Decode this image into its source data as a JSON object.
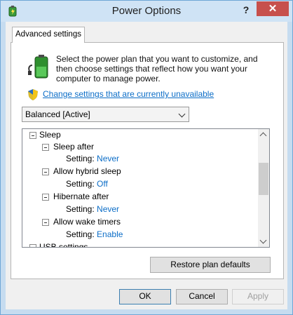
{
  "window": {
    "title": "Power Options",
    "help_label": "?",
    "close_label": "✕"
  },
  "tabs": [
    {
      "label": "Advanced settings"
    }
  ],
  "intro": {
    "description": "Select the power plan that you want to customize, and then choose settings that reflect how you want your computer to manage power."
  },
  "change_link": "Change settings that are currently unavailable",
  "plan_select": {
    "selected": "Balanced [Active]"
  },
  "tree": {
    "sleep": "Sleep",
    "sleep_after": {
      "label": "Sleep after",
      "setting_label": "Setting:",
      "value": "Never"
    },
    "hybrid_sleep": {
      "label": "Allow hybrid sleep",
      "setting_label": "Setting:",
      "value": "Off"
    },
    "hibernate_after": {
      "label": "Hibernate after",
      "setting_label": "Setting:",
      "value": "Never"
    },
    "wake_timers": {
      "label": "Allow wake timers",
      "setting_label": "Setting:",
      "value": "Enable"
    },
    "usb": "USB settings"
  },
  "buttons": {
    "restore": "Restore plan defaults",
    "ok": "OK",
    "cancel": "Cancel",
    "apply": "Apply"
  },
  "colors": {
    "link": "#0b6dc7",
    "titlebar": "#cfe3f5",
    "close": "#c7504c"
  }
}
